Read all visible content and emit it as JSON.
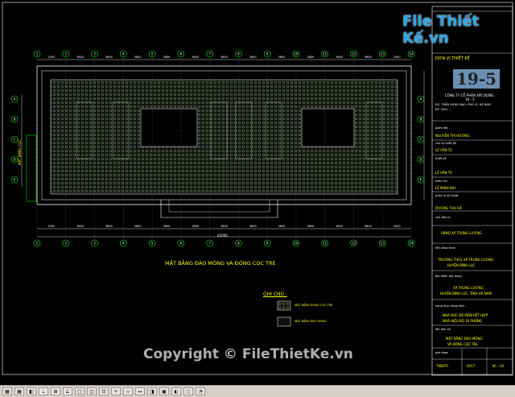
{
  "watermark": {
    "brand": "File Thiết Kế.vn",
    "copyright": "Copyright © FileThietKe.vn"
  },
  "drawing": {
    "title": "MẶT BẰNG ĐÀO MÓNG VÀ ĐÓNG CỌC TRE",
    "legend_title": "GHI CHÚ :",
    "legend_items": [
      "MẶT BẰNG ĐÓNG CỌC TRE",
      "MẶT BẰNG ĐÀO MÓNG"
    ],
    "side_label": "MẶT BẰNG CỌC",
    "dims_top": [
      "2500",
      "3600",
      "3600",
      "3600",
      "3600",
      "3600",
      "3600",
      "3600",
      "3600",
      "3600",
      "3600",
      "3600",
      "2500"
    ],
    "total_dim": "42000",
    "axes_top": [
      "1",
      "2",
      "3",
      "4",
      "5",
      "6",
      "7",
      "8",
      "9",
      "10",
      "11",
      "12",
      "13",
      "14"
    ],
    "axes_left": [
      "A",
      "B",
      "C",
      "D",
      "E"
    ]
  },
  "titleblock": {
    "unit_label": "ĐƠN VỊ THIẾT KẾ",
    "logo": "19-5",
    "company": "CÔNG TY CỔ PHẦN XÂY DỰNG",
    "company_sub": "19 - 5",
    "address": "ĐC: TRẦN HƯNG ĐẠO, PHỦ LÝ, HÀ NAM",
    "phone": "ĐT: 0351 ...",
    "rows": [
      {
        "label": "giám đốc",
        "value": "NGUYỄN THỊ HƯƠNG"
      },
      {
        "label": "chủ trì thiết kế",
        "value": "LÊ VĂN TÚ"
      },
      {
        "label": "thiết kế",
        "value": "LÊ VĂN TÚ"
      },
      {
        "label": "kiểm tra",
        "value": "LÊ MINH ĐẠI"
      },
      {
        "label": "quản lý kỹ thuật",
        "value": "DƯƠNG THU HÀ"
      }
    ],
    "investor_label": "chủ đầu tư",
    "investor": "UBND XÃ TRUNG LƯƠNG",
    "project_label": "tên công trình",
    "project": "TRƯỜNG THCS XÃ TRUNG LƯƠNG",
    "project_sub": "HUYỆN BÌNH LỤC",
    "location_label": "địa điểm xây dựng",
    "location": "XÃ TRUNG LƯƠNG",
    "location_sub": "HUYỆN BÌNH LỤC, TỈNH HÀ NAM",
    "item_label": "hạng mục công trình",
    "item": "NHÀ HỌC BỘ MÔN KẾT HỢP",
    "item_sub": "NHÀ HIỆU BỘ 16 PHÒNG",
    "sheet_label": "tên bản vẽ",
    "sheet_title": "MẶT BẰNG ĐÀO MÓNG",
    "sheet_title_sub": "VÀ ĐÓNG CỌC TRE",
    "phase_label": "giai đoạn",
    "phase": "TKBVTC",
    "year": "2017",
    "sheet_no": "KC - 02"
  },
  "statusbar": {
    "coords": "",
    "buttons": [
      "▦",
      "▦",
      "◧",
      "⊥",
      "⊞",
      "∠",
      "□",
      "◫",
      "⊡",
      "+",
      "⊹",
      "↔",
      "◨",
      "▣",
      "◐",
      "○",
      "◔"
    ]
  }
}
